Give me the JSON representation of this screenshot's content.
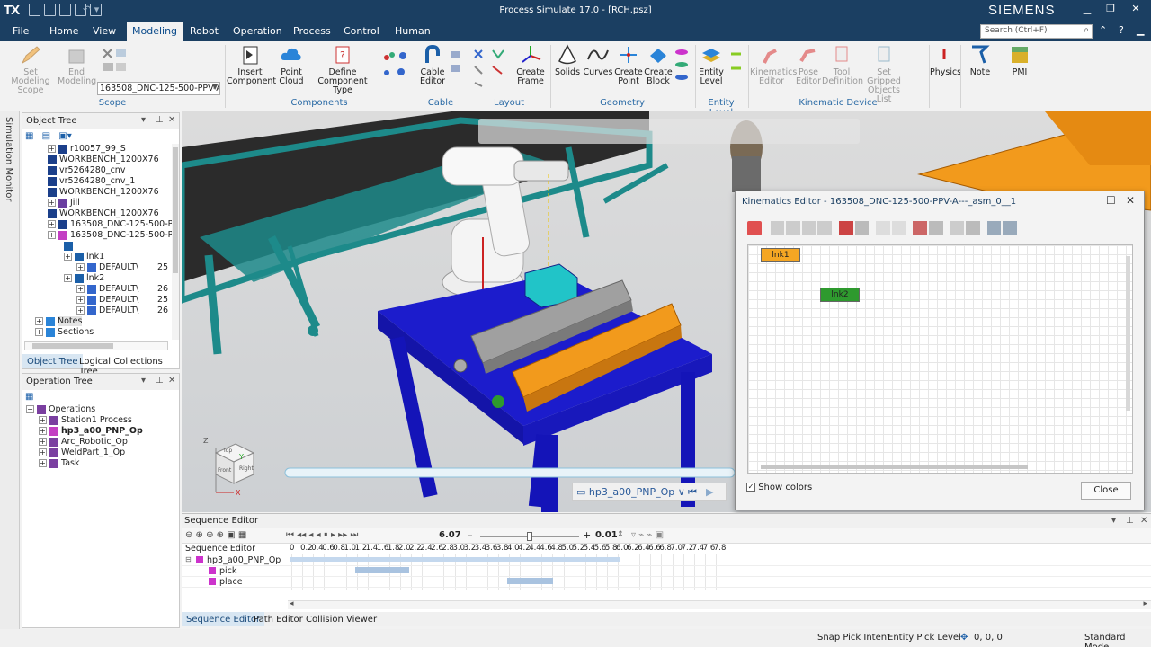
{
  "titlebar": {
    "logo": "TX",
    "title": "Process Simulate 17.0 - [RCH.psz]",
    "brand": "SIEMENS"
  },
  "menu": {
    "items": [
      "File",
      "Home",
      "View",
      "Modeling",
      "Robot",
      "Operation",
      "Process",
      "Control",
      "Human"
    ],
    "active": "Modeling",
    "search_placeholder": "Search (Ctrl+F)"
  },
  "ribbon": {
    "scope": {
      "set_modeling_scope": "Set Modeling Scope",
      "end_modeling": "End Modeling",
      "selected_component": "163508_DNC-125-500-PPV-A",
      "group_label": "Scope"
    },
    "components": {
      "insert_component": "Insert Component",
      "point_cloud": "Point Cloud",
      "define_component_type": "Define Component Type",
      "group_label": "Components"
    },
    "cable": {
      "cable_editor": "Cable Editor",
      "group_label": "Cable"
    },
    "layout": {
      "create_frame": "Create Frame",
      "group_label": "Layout"
    },
    "geometry": {
      "solids": "Solids",
      "curves": "Curves",
      "create_point": "Create Point",
      "create_block": "Create Block",
      "group_label": "Geometry"
    },
    "entity_level": {
      "entity_level": "Entity Level",
      "group_label": "Entity Level"
    },
    "kinematic_device": {
      "kinematics_editor": "Kinematics Editor",
      "pose_editor": "Pose Editor",
      "tool_definition": "Tool Definition",
      "set_gripped_objects_list": "Set Gripped Objects List",
      "group_label": "Kinematic Device"
    },
    "misc": {
      "physics": "Physics",
      "note": "Note",
      "pmi": "PMI"
    }
  },
  "side_tab": "Simulation Monitor",
  "object_tree": {
    "title": "Object Tree",
    "rows": [
      "r10057_99_S",
      "WORKBENCH_1200X76",
      "vr5264280_cnv",
      "vr5264280_cnv_1",
      "WORKBENCH_1200X76",
      "Jill",
      "WORKBENCH_1200X76",
      "163508_DNC-125-500-PF",
      "163508_DNC-125-500-PF",
      "",
      "lnk1",
      "DEFAULT\\",
      "lnk2",
      "DEFAULT\\",
      "DEFAULT\\",
      "DEFAULT\\",
      "Notes",
      "Sections"
    ],
    "values": {
      "r11": "25",
      "r13": "26",
      "r14": "25",
      "r15": "26"
    },
    "tabs": [
      "Object Tree",
      "Logical Collections Tree"
    ]
  },
  "operation_tree": {
    "title": "Operation Tree",
    "rows": [
      "Operations",
      "Station1 Process",
      "hp3_a00_PNP_Op",
      "Arc_Robotic_Op",
      "WeldPart_1_Op",
      "Task"
    ]
  },
  "viewport": {
    "operation_selector": "hp3_a00_PNP_Op",
    "cube_labels": {
      "top": "Top",
      "right": "Right",
      "front": "Front"
    },
    "axis": {
      "x": "X",
      "y": "Y",
      "z": "Z"
    }
  },
  "kinematics_editor": {
    "title": "Kinematics Editor -  163508_DNC-125-500-PPV-A---_asm_0__1",
    "links": [
      "lnk1",
      "lnk2"
    ],
    "show_colors": "Show colors",
    "close": "Close",
    "colors": {
      "lnk1": "#f5a623",
      "lnk2": "#2e9a2e"
    }
  },
  "sequence_editor": {
    "title": "Sequence Editor",
    "column_header": "Sequence Editor",
    "time_value": "6.07",
    "step_value": "0.01",
    "ticks": [
      "0",
      "0.2",
      "0.4",
      "0.6",
      "0.8",
      "1.0",
      "1.2",
      "1.4",
      "1.6",
      "1.8",
      "2.0",
      "2.2",
      "2.4",
      "2.6",
      "2.8",
      "3.0",
      "3.2",
      "3.4",
      "3.6",
      "3.8",
      "4.0",
      "4.2",
      "4.4",
      "4.6",
      "4.8",
      "5.0",
      "5.2",
      "5.4",
      "5.6",
      "5.8",
      "6.0",
      "6.2",
      "6.4",
      "6.6",
      "6.8",
      "7.0",
      "7.2",
      "7.4",
      "7.6",
      "7.8"
    ],
    "rows": [
      "hp3_a00_PNP_Op",
      "pick",
      "place"
    ],
    "segments": {
      "op": [
        0,
        6.07
      ],
      "pick": [
        1.2,
        2.2
      ],
      "place": [
        4.0,
        4.85
      ]
    },
    "current_time": 6.07,
    "tabs": [
      "Sequence Editor",
      "Path Editor",
      "Collision Viewer"
    ]
  },
  "status": {
    "snap": "Snap Pick Intent",
    "pick_level": "Entity Pick Level",
    "coords": "0, 0, 0",
    "mode": "Standard Mode"
  }
}
